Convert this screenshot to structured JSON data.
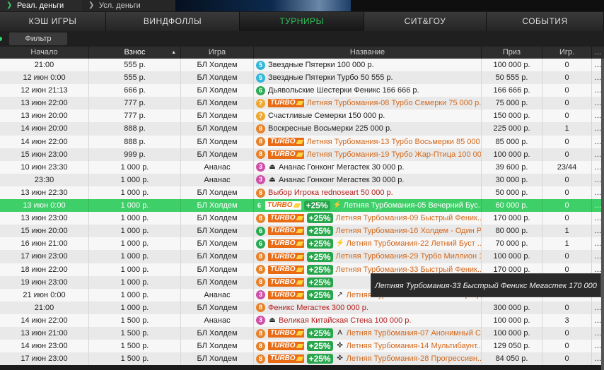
{
  "modes": {
    "real": "Реал. деньги",
    "conditional": "Усл. деньги"
  },
  "tabs": [
    {
      "label": "КЭШ ИГРЫ",
      "active": false
    },
    {
      "label": "ВИНДФОЛЛЫ",
      "active": false
    },
    {
      "label": "ТУРНИРЫ",
      "active": true
    },
    {
      "label": "СИТ&ГОУ",
      "active": false
    },
    {
      "label": "СОБЫТИЯ",
      "active": false
    }
  ],
  "filter_label": "Фильтр",
  "columns": {
    "start": "Начало",
    "fee": "Взнос",
    "game": "Игра",
    "name": "Название",
    "prize": "Приз",
    "players": "Игр.",
    "more": "..."
  },
  "colors": {
    "accent": "#31c25c",
    "selected_row": "#3fcf68",
    "turbo": "#e96b13",
    "bonus": "#27a64c"
  },
  "rows": [
    {
      "start": "21:00",
      "fee": "555 р.",
      "game": "БЛ Холдем",
      "badge": "5",
      "badge_color": "#33b6d8",
      "turbo": false,
      "bonus": "",
      "sym": "",
      "name": "Звездные Пятерки 100 000 р.",
      "style": "normal",
      "prize": "100 000 р.",
      "players": "0",
      "more": "..."
    },
    {
      "start": "12 июн 0:00",
      "fee": "555 р.",
      "game": "БЛ Холдем",
      "badge": "5",
      "badge_color": "#33b6d8",
      "turbo": false,
      "bonus": "",
      "sym": "",
      "name": "Звездные Пятерки Турбо 50 555 р.",
      "style": "normal",
      "prize": "50 555 р.",
      "players": "0",
      "more": "..."
    },
    {
      "start": "12 июн 21:13",
      "fee": "666 р.",
      "game": "БЛ Холдем",
      "badge": "6",
      "badge_color": "#2aaa55",
      "turbo": false,
      "bonus": "",
      "sym": "",
      "name": "Дьявольские Шестерки Феникс 166 666 р.",
      "style": "normal",
      "prize": "166 666 р.",
      "players": "0",
      "more": "..."
    },
    {
      "start": "13 июн 22:00",
      "fee": "777 р.",
      "game": "БЛ Холдем",
      "badge": "?",
      "badge_color": "#f0a830",
      "turbo": true,
      "bonus": "",
      "sym": "",
      "name": "Летняя Турбомания-08 Турбо Семерки 75 000 р.",
      "style": "orange",
      "prize": "75 000 р.",
      "players": "0",
      "more": "..."
    },
    {
      "start": "13 июн 20:00",
      "fee": "777 р.",
      "game": "БЛ Холдем",
      "badge": "?",
      "badge_color": "#f0a830",
      "turbo": false,
      "bonus": "",
      "sym": "",
      "name": "Счастливые Семерки 150 000 р.",
      "style": "normal",
      "prize": "150 000 р.",
      "players": "0",
      "more": "..."
    },
    {
      "start": "14 июн 20:00",
      "fee": "888 р.",
      "game": "БЛ Холдем",
      "badge": "8",
      "badge_color": "#e8822a",
      "turbo": false,
      "bonus": "",
      "sym": "",
      "name": "Воскресные Восьмерки 225 000 р.",
      "style": "normal",
      "prize": "225 000 р.",
      "players": "1",
      "more": "..."
    },
    {
      "start": "14 июн 22:00",
      "fee": "888 р.",
      "game": "БЛ Холдем",
      "badge": "8",
      "badge_color": "#e8822a",
      "turbo": true,
      "bonus": "",
      "sym": "",
      "name": "Летняя Турбомания-13 Турбо Восьмерки 85 000 р.",
      "style": "orange",
      "prize": "85 000 р.",
      "players": "0",
      "more": "..."
    },
    {
      "start": "15 июн 23:00",
      "fee": "999 р.",
      "game": "БЛ Холдем",
      "badge": "8",
      "badge_color": "#e8822a",
      "turbo": true,
      "bonus": "",
      "sym": "",
      "name": "Летняя Турбомания-19 Турбо Жар-Птица 100 000 р.",
      "style": "orange",
      "prize": "100 000 р.",
      "players": "0",
      "more": "..."
    },
    {
      "start": "10 июн 23:30",
      "fee": "1 000 р.",
      "game": "Ананас",
      "badge": "3",
      "badge_color": "#d04fa8",
      "turbo": false,
      "bonus": "",
      "sym": "⏏",
      "name": "Ананас Гонконг Мегастек 30 000 р.",
      "style": "normal",
      "prize": "39 600 р.",
      "players": "23/44",
      "more": "..."
    },
    {
      "start": "23:30",
      "fee": "1 000 р.",
      "game": "Ананас",
      "badge": "3",
      "badge_color": "#d04fa8",
      "turbo": false,
      "bonus": "",
      "sym": "⏏",
      "name": "Ананас Гонконг Мегастек 30 000 р.",
      "style": "normal",
      "prize": "30 000 р.",
      "players": "0",
      "more": "..."
    },
    {
      "start": "13 июн 22:30",
      "fee": "1 000 р.",
      "game": "БЛ Холдем",
      "badge": "8",
      "badge_color": "#e8822a",
      "turbo": false,
      "bonus": "",
      "sym": "",
      "name": "Выбор Игрока rednoseart 50 000 р.",
      "style": "red",
      "prize": "50 000 р.",
      "players": "0",
      "more": "..."
    },
    {
      "start": "13 июн 0:00",
      "fee": "1 000 р.",
      "game": "БЛ Холдем",
      "badge": "6",
      "badge_color": "#2aaa55",
      "turbo": true,
      "bonus": "+25%",
      "sym": "⚡",
      "name": "Летняя Турбомания-05 Вечерний Бус...",
      "style": "orange",
      "prize": "60 000 р.",
      "players": "0",
      "more": "...",
      "selected": true
    },
    {
      "start": "13 июн 23:00",
      "fee": "1 000 р.",
      "game": "БЛ Холдем",
      "badge": "8",
      "badge_color": "#e8822a",
      "turbo": true,
      "bonus": "+25%",
      "sym": "",
      "name": "Летняя Турбомания-09 Быстрый Феник...",
      "style": "orange",
      "prize": "170 000 р.",
      "players": "0",
      "more": "..."
    },
    {
      "start": "15 июн 20:00",
      "fee": "1 000 р.",
      "game": "БЛ Холдем",
      "badge": "6",
      "badge_color": "#2aaa55",
      "turbo": true,
      "bonus": "+25%",
      "sym": "",
      "name": "Летняя Турбомания-16 Холдем - Один Р...",
      "style": "orange",
      "prize": "80 000 р.",
      "players": "1",
      "more": "..."
    },
    {
      "start": "16 июн 21:00",
      "fee": "1 000 р.",
      "game": "БЛ Холдем",
      "badge": "6",
      "badge_color": "#2aaa55",
      "turbo": true,
      "bonus": "+25%",
      "sym": "⚡",
      "name": "Летняя Турбомания-22 Летний Буст ...",
      "style": "orange",
      "prize": "70 000 р.",
      "players": "1",
      "more": "..."
    },
    {
      "start": "17 июн 23:00",
      "fee": "1 000 р.",
      "game": "БЛ Холдем",
      "badge": "8",
      "badge_color": "#e8822a",
      "turbo": true,
      "bonus": "+25%",
      "sym": "",
      "name": "Летняя Турбомания-29 Турбо Миллион 1...",
      "style": "orange",
      "prize": "100 000 р.",
      "players": "0",
      "more": "..."
    },
    {
      "start": "18 июн 22:00",
      "fee": "1 000 р.",
      "game": "БЛ Холдем",
      "badge": "8",
      "badge_color": "#e8822a",
      "turbo": true,
      "bonus": "+25%",
      "sym": "",
      "name": "Летняя Турбомания-33 Быстрый Феник...",
      "style": "orange",
      "prize": "170 000 р.",
      "players": "0",
      "more": "..."
    },
    {
      "start": "19 июн 23:00",
      "fee": "1 000 р.",
      "game": "БЛ Холдем",
      "badge": "8",
      "badge_color": "#e8822a",
      "turbo": true,
      "bonus": "+25%",
      "sym": "",
      "name": "",
      "style": "orange",
      "prize": "",
      "players": "0",
      "more": "..."
    },
    {
      "start": "21 июн 0:00",
      "fee": "1 000 р.",
      "game": "Ананас",
      "badge": "3",
      "badge_color": "#d04fa8",
      "turbo": true,
      "bonus": "+25%",
      "sym": "↗",
      "name": "Летняя Турбомания-45 Ананас Прогр...",
      "style": "orange",
      "prize": "",
      "players": "0",
      "more": "..."
    },
    {
      "start": "21:00",
      "fee": "1 000 р.",
      "game": "БЛ Холдем",
      "badge": "8",
      "badge_color": "#e8822a",
      "turbo": false,
      "bonus": "",
      "sym": "",
      "name": "Феникс Мегастек 300 000 р.",
      "style": "red",
      "prize": "300 000 р.",
      "players": "0",
      "more": "..."
    },
    {
      "start": "14 июн 22:00",
      "fee": "1 500 р.",
      "game": "Ананас",
      "badge": "3",
      "badge_color": "#d04fa8",
      "turbo": false,
      "bonus": "",
      "sym": "⏏",
      "name": "Великая Китайская Стена 100 000 р.",
      "style": "red",
      "prize": "100 000 р.",
      "players": "3",
      "more": "..."
    },
    {
      "start": "13 июн 21:00",
      "fee": "1 500 р.",
      "game": "БЛ Холдем",
      "badge": "8",
      "badge_color": "#e8822a",
      "turbo": true,
      "bonus": "+25%",
      "sym": "A",
      "name": "Летняя Турбомания-07 Анонимный С...",
      "style": "orange",
      "prize": "100 000 р.",
      "players": "0",
      "more": "..."
    },
    {
      "start": "14 июн 23:00",
      "fee": "1 500 р.",
      "game": "БЛ Холдем",
      "badge": "8",
      "badge_color": "#e8822a",
      "turbo": true,
      "bonus": "+25%",
      "sym": "✜",
      "name": "Летняя Турбомания-14 Мультибаунт...",
      "style": "orange",
      "prize": "129 050 р.",
      "players": "0",
      "more": "..."
    },
    {
      "start": "17 июн 23:00",
      "fee": "1 500 р.",
      "game": "БЛ Холдем",
      "badge": "8",
      "badge_color": "#e8822a",
      "turbo": true,
      "bonus": "+25%",
      "sym": "✜",
      "name": "Летняя Турбомания-28 Прогрессивн...",
      "style": "orange",
      "prize": "84 050 р.",
      "players": "0",
      "more": "..."
    }
  ],
  "tooltip": "Летняя Турбомания-33 Быстрый Феникс Мегастек 170 000 р."
}
